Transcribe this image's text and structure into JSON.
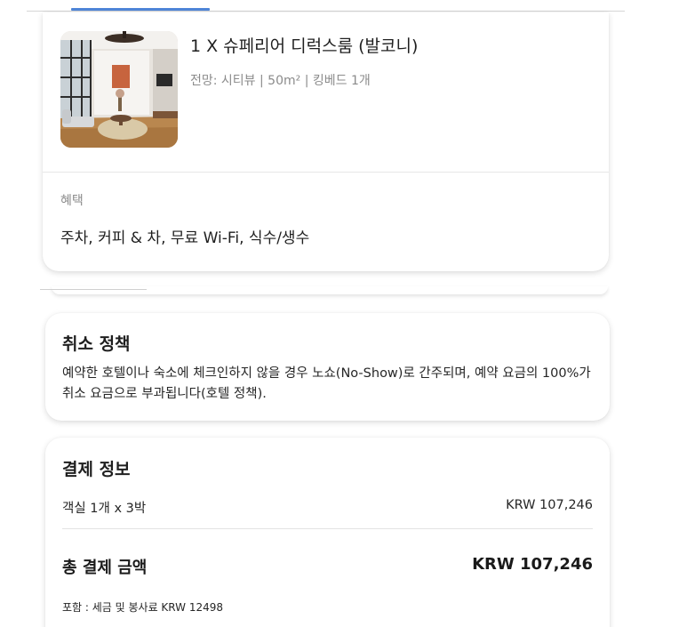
{
  "room": {
    "title": "1 X 슈페리어 디럭스룸 (발코니)",
    "details": "전망: 시티뷰 | 50m² | 킹베드 1개",
    "image_alt": "room-photo"
  },
  "benefits": {
    "label": "혜택",
    "value": "주차, 커피 & 차, 무료 Wi-Fi, 식수/생수"
  },
  "cancellation": {
    "title": "취소 정책",
    "text": "예약한 호텔이나 숙소에 체크인하지 않을 경우 노쇼(No-Show)로 간주되며, 예약 요금의 100%가 취소 요금으로 부과됩니다(호텔 정책)."
  },
  "payment": {
    "title": "결제 정보",
    "room_line_label": "객실 1개 x 3박",
    "room_line_amount": "KRW 107,246",
    "total_label": "총 결제 금액",
    "total_amount": "KRW 107,246",
    "note": "포함 : 세금 및 봉사료 KRW 12498"
  },
  "colors": {
    "accent": "#4f86d8",
    "muted_text": "#8b8b8b",
    "primary_text": "#1f1f1f"
  }
}
